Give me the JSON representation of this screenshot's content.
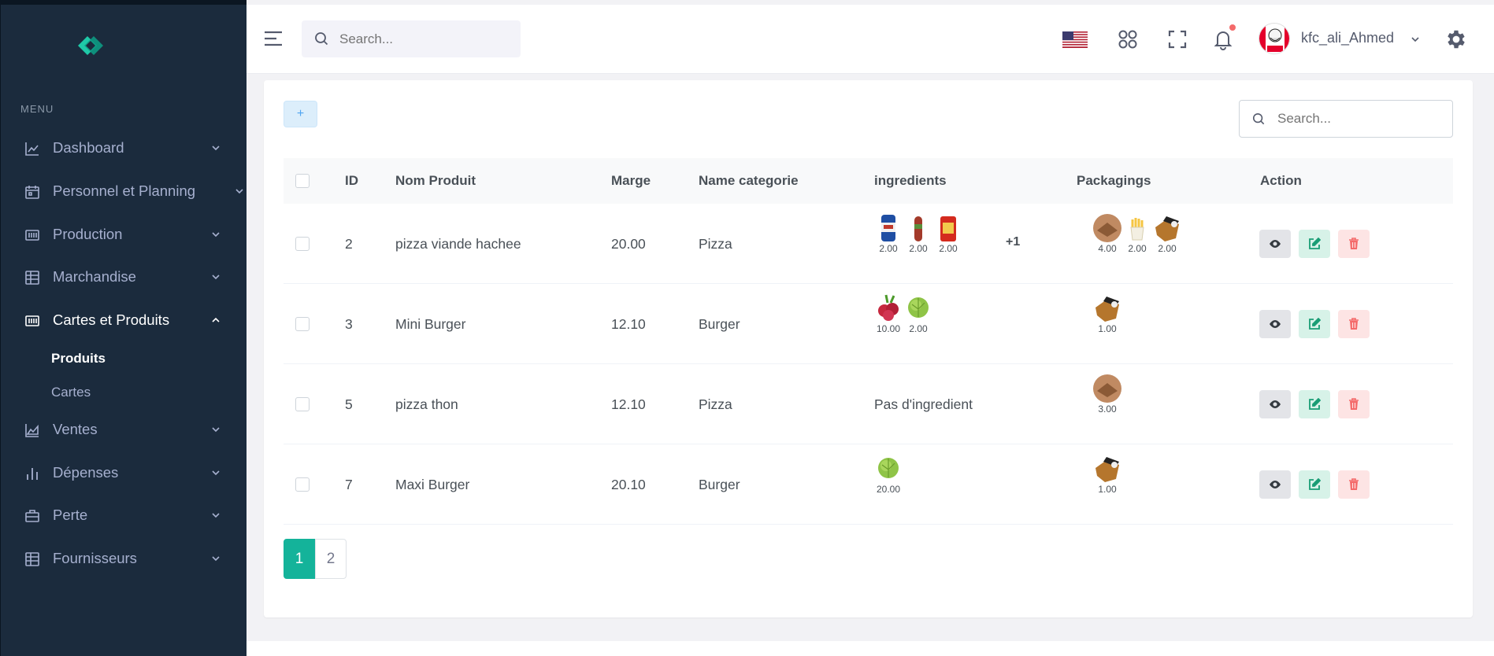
{
  "sidebar": {
    "menu_title": "MENU",
    "items": [
      {
        "label": "Dashboard",
        "icon": "chart-line-icon"
      },
      {
        "label": "Personnel et Planning",
        "icon": "calendar-icon"
      },
      {
        "label": "Production",
        "icon": "grid-box-icon"
      },
      {
        "label": "Marchandise",
        "icon": "table-icon"
      },
      {
        "label": "Cartes et Produits",
        "icon": "grid-box-icon"
      },
      {
        "label": "Ventes",
        "icon": "chart-area-icon"
      },
      {
        "label": "Dépenses",
        "icon": "bar-chart-icon"
      },
      {
        "label": "Perte",
        "icon": "briefcase-icon"
      },
      {
        "label": "Fournisseurs",
        "icon": "table-icon"
      }
    ],
    "subitems": [
      {
        "label": "Produits"
      },
      {
        "label": "Cartes"
      }
    ]
  },
  "topbar": {
    "search_placeholder": "Search...",
    "username": "kfc_ali_Ahmed"
  },
  "toolbar": {
    "add_label": "+",
    "search_placeholder": "Search..."
  },
  "table": {
    "headers": {
      "id": "ID",
      "nom": "Nom Produit",
      "marge": "Marge",
      "categorie": "Name categorie",
      "ingredients": "ingredients",
      "packagings": "Packagings",
      "action": "Action"
    },
    "rows": [
      {
        "id": "2",
        "nom": "pizza viande hachee",
        "marge": "20.00",
        "categorie": "Pizza",
        "ingredients": [
          {
            "icon": "milk-can-icon",
            "qty": "2.00"
          },
          {
            "icon": "sausage-icon",
            "qty": "2.00"
          },
          {
            "icon": "sauce-bottle-icon",
            "qty": "2.00"
          }
        ],
        "ingredients_more": "+1",
        "packagings": [
          {
            "icon": "pizza-box-icon",
            "qty": "4.00"
          },
          {
            "icon": "fries-box-icon",
            "qty": "2.00"
          },
          {
            "icon": "burger-box-icon",
            "qty": "2.00"
          }
        ]
      },
      {
        "id": "3",
        "nom": "Mini Burger",
        "marge": "12.10",
        "categorie": "Burger",
        "ingredients": [
          {
            "icon": "radish-icon",
            "qty": "10.00"
          },
          {
            "icon": "lettuce-icon",
            "qty": "2.00"
          }
        ],
        "ingredients_text": "",
        "packagings": [
          {
            "icon": "burger-box-icon",
            "qty": "1.00"
          }
        ]
      },
      {
        "id": "5",
        "nom": "pizza thon",
        "marge": "12.10",
        "categorie": "Pizza",
        "ingredients": [],
        "ingredients_text": "Pas d'ingredient",
        "packagings": [
          {
            "icon": "pizza-box-icon",
            "qty": "3.00"
          }
        ]
      },
      {
        "id": "7",
        "nom": "Maxi Burger",
        "marge": "20.10",
        "categorie": "Burger",
        "ingredients": [
          {
            "icon": "lettuce-icon",
            "qty": "20.00"
          }
        ],
        "ingredients_text": "",
        "packagings": [
          {
            "icon": "burger-box-icon",
            "qty": "1.00"
          }
        ]
      }
    ]
  },
  "pagination": {
    "pages": [
      "1",
      "2"
    ],
    "current": "1"
  },
  "colors": {
    "sidebar_bg": "#1b2b3d",
    "accent": "#14b39a",
    "danger": "#f46a6a",
    "info": "#50a5f1"
  }
}
